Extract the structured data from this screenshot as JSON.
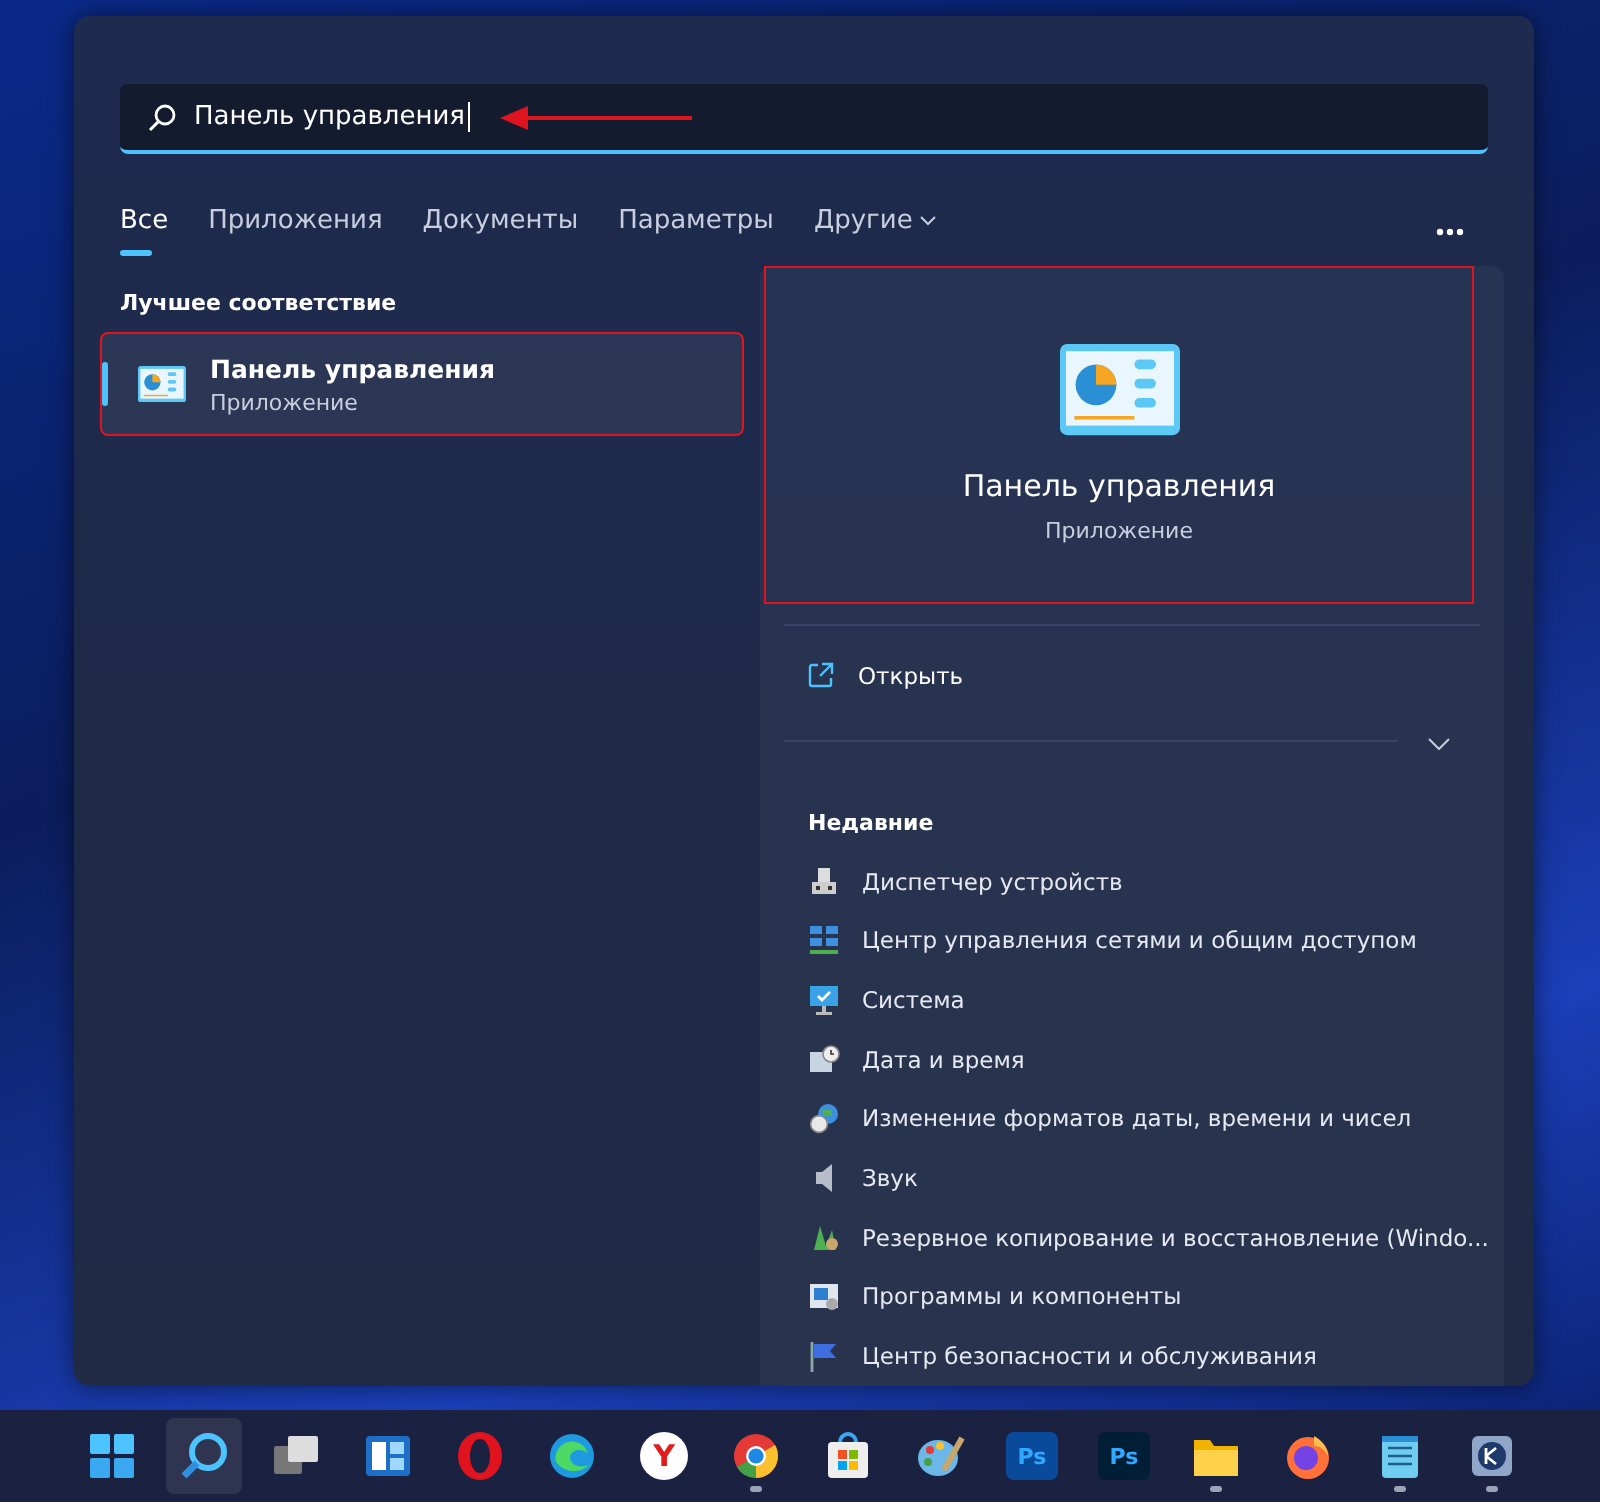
{
  "search": {
    "value": "Панель управления",
    "arrow_annotation": true
  },
  "tabs": [
    {
      "label": "Все",
      "selected": true,
      "dropdown": false
    },
    {
      "label": "Приложения",
      "selected": false,
      "dropdown": false
    },
    {
      "label": "Документы",
      "selected": false,
      "dropdown": false
    },
    {
      "label": "Параметры",
      "selected": false,
      "dropdown": false
    },
    {
      "label": "Другие",
      "selected": false,
      "dropdown": true
    }
  ],
  "best_match": {
    "heading": "Лучшее соответствие",
    "title": "Панель управления",
    "subtitle": "Приложение",
    "selected": true,
    "highlighted": true
  },
  "preview": {
    "title": "Панель управления",
    "subtitle": "Приложение",
    "highlighted": true
  },
  "actions": [
    {
      "label": "Открыть"
    }
  ],
  "recent": {
    "heading": "Недавние",
    "expanded": false,
    "items": [
      {
        "label": "Диспетчер устройств",
        "kind": "devices"
      },
      {
        "label": "Центр управления сетями и общим доступом",
        "kind": "network"
      },
      {
        "label": "Система",
        "kind": "system"
      },
      {
        "label": "Дата и время",
        "kind": "datetime"
      },
      {
        "label": "Изменение форматов даты, времени и чисел",
        "kind": "region"
      },
      {
        "label": "Звук",
        "kind": "sound"
      },
      {
        "label": "Резервное копирование и восстановление (Windo...",
        "kind": "backup"
      },
      {
        "label": "Программы и компоненты",
        "kind": "programs"
      },
      {
        "label": "Центр безопасности и обслуживания",
        "kind": "security"
      }
    ]
  },
  "taskbar": [
    {
      "kind": "start",
      "selected": false,
      "running": false
    },
    {
      "kind": "search",
      "selected": true,
      "running": false
    },
    {
      "kind": "taskview",
      "selected": false,
      "running": false
    },
    {
      "kind": "widgets",
      "selected": false,
      "running": false
    },
    {
      "kind": "opera",
      "selected": false,
      "running": false
    },
    {
      "kind": "edge",
      "selected": false,
      "running": false
    },
    {
      "kind": "yandex",
      "label": "Y",
      "selected": false,
      "running": false
    },
    {
      "kind": "chrome",
      "selected": false,
      "running": true
    },
    {
      "kind": "store",
      "selected": false,
      "running": false
    },
    {
      "kind": "paint",
      "selected": false,
      "running": false
    },
    {
      "kind": "photoshop",
      "label": "Ps",
      "selected": false,
      "running": false
    },
    {
      "kind": "photoshop-dark",
      "label": "Ps",
      "selected": false,
      "running": false
    },
    {
      "kind": "folder",
      "selected": false,
      "running": true
    },
    {
      "kind": "firefox",
      "selected": false,
      "running": false
    },
    {
      "kind": "notepad",
      "selected": false,
      "running": true
    },
    {
      "kind": "app",
      "selected": false,
      "running": true
    }
  ]
}
